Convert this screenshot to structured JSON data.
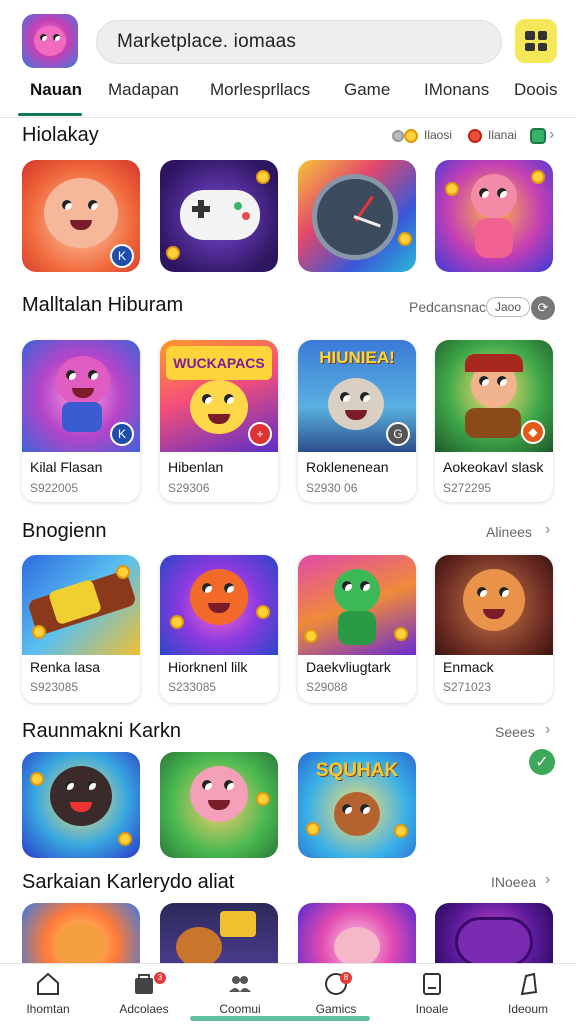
{
  "header": {
    "search_text": "Marketplace. iomaas",
    "grid_icon": "grid-icon"
  },
  "tabs": [
    {
      "label": "Nauan",
      "active": true
    },
    {
      "label": "Madapan",
      "active": false
    },
    {
      "label": "Morlesprllacs",
      "active": false
    },
    {
      "label": "Game",
      "active": false
    },
    {
      "label": "IMonans",
      "active": false
    },
    {
      "label": "Doois",
      "active": false
    }
  ],
  "sections": {
    "s1": {
      "title": "Hiolakay",
      "chips": [
        "Ilaosi",
        "Ilanai"
      ]
    },
    "s2": {
      "title": "Malltalan Hiburam",
      "link": "Pedcansnac",
      "pill": "Jaoo",
      "cards": [
        {
          "name": "Kilal Flasan",
          "price": "S922005"
        },
        {
          "name": "Hibenlan",
          "price": "S29306"
        },
        {
          "name": "Roklenenean",
          "price": "S2930 06"
        },
        {
          "name": "Aokeokavl slask",
          "price": "S272295"
        }
      ]
    },
    "s3": {
      "title": "Bnogienn",
      "link": "Alinees",
      "cards": [
        {
          "name": "Renka lasa",
          "price": "S923085"
        },
        {
          "name": "Hiorknenl lilk",
          "price": "S233085"
        },
        {
          "name": "Daekvliugtark",
          "price": "S29088"
        },
        {
          "name": "Enmack",
          "price": "S271023"
        }
      ]
    },
    "s4": {
      "title": "Raunmakni Karkn",
      "link": "Seees"
    },
    "s5": {
      "title": "Sarkaian Karlerydo aliat",
      "link": "INoeea"
    }
  },
  "tile_text": {
    "s2_art2": "WUCKAPACS",
    "s2_art3": "HIUNIEA!",
    "s4_art3": "SQUHAK"
  },
  "bottom_nav": [
    {
      "label": "Ihomtan",
      "icon": "home-icon"
    },
    {
      "label": "Adcolaes",
      "icon": "bag-icon",
      "badge": "3"
    },
    {
      "label": "Coomui",
      "icon": "people-icon"
    },
    {
      "label": "Gamics",
      "icon": "chat-icon",
      "badge": "8"
    },
    {
      "label": "Inoale",
      "icon": "box-icon"
    },
    {
      "label": "Ideoum",
      "icon": "profile-icon"
    }
  ],
  "colors": {
    "accent": "#0f7a5c",
    "search_bg": "#eeeeee",
    "grid_button": "#f4e85a"
  }
}
